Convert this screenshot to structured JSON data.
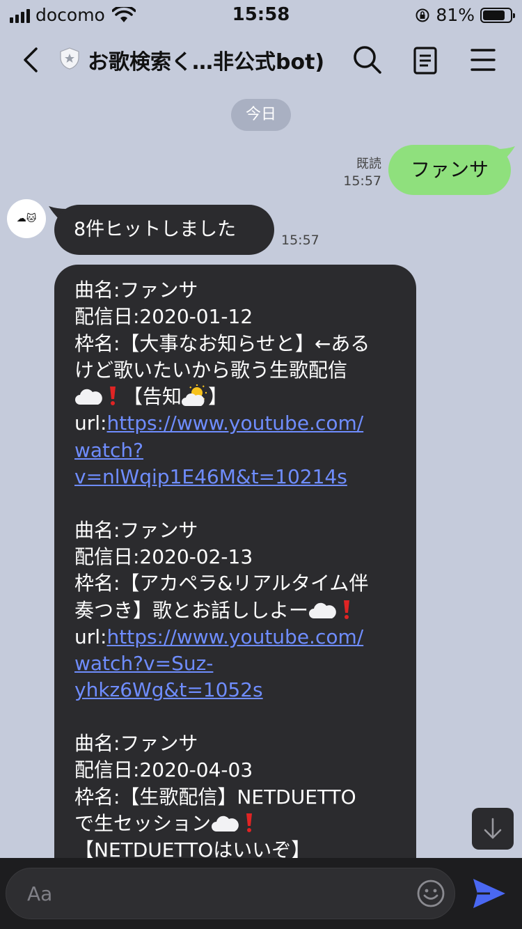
{
  "status_bar": {
    "carrier": "docomo",
    "time": "15:58",
    "battery": "81%",
    "battery_level": 0.81
  },
  "header": {
    "title": "お歌検索く…非公式bot)"
  },
  "date_pill": "今日",
  "messages": {
    "sent": {
      "text": "ファンサ",
      "read": "既読",
      "time": "15:57"
    },
    "received_short": {
      "text": "8件ヒットしました",
      "time": "15:57",
      "avatar_text": "☁🐱"
    },
    "results": [
      {
        "song": "曲名:ファンサ",
        "date": "配信日:2020-01-12",
        "frame_1": "枠名:【大事なお知らせと】←ある",
        "frame_2": "けど歌いたいから歌う生歌配信",
        "frame_3_prefix": "",
        "frame_3_suffix": "【告知",
        "frame_3_end": "】",
        "url_label": "url:",
        "url_1": "https://www.youtube.com/",
        "url_2": "watch?",
        "url_3": "v=nlWqip1E46M&t=10214s"
      },
      {
        "song": "曲名:ファンサ",
        "date": "配信日:2020-02-13",
        "frame_1": "枠名:【アカペラ&リアルタイム伴",
        "frame_2": "奏つき】歌とお話ししよー",
        "url_label": "url:",
        "url_1": "https://www.youtube.com/",
        "url_2": "watch?v=Suz-",
        "url_3": "yhkz6Wg&t=1052s"
      },
      {
        "song": "曲名:ファンサ",
        "date": "配信日:2020-04-03",
        "frame_1": "枠名:【生歌配信】NETDUETTO",
        "frame_2": "で生セッション",
        "frame_3": "【NETDUETTOはいいぞ】"
      }
    ]
  },
  "input": {
    "placeholder": "Aa"
  },
  "icons": {
    "back": "chevron-left-icon",
    "shield": "shield-star-icon",
    "search": "search-icon",
    "notes": "notes-icon",
    "menu": "hamburger-menu-icon",
    "scroll_down": "arrow-down-icon",
    "emoji": "smiley-icon",
    "send": "send-icon"
  },
  "colors": {
    "background": "#c5cbdb",
    "sent_bubble": "#8fe07d",
    "received_bubble": "#2b2b2e",
    "link": "#6f8dff",
    "send_icon": "#4a68f2"
  }
}
